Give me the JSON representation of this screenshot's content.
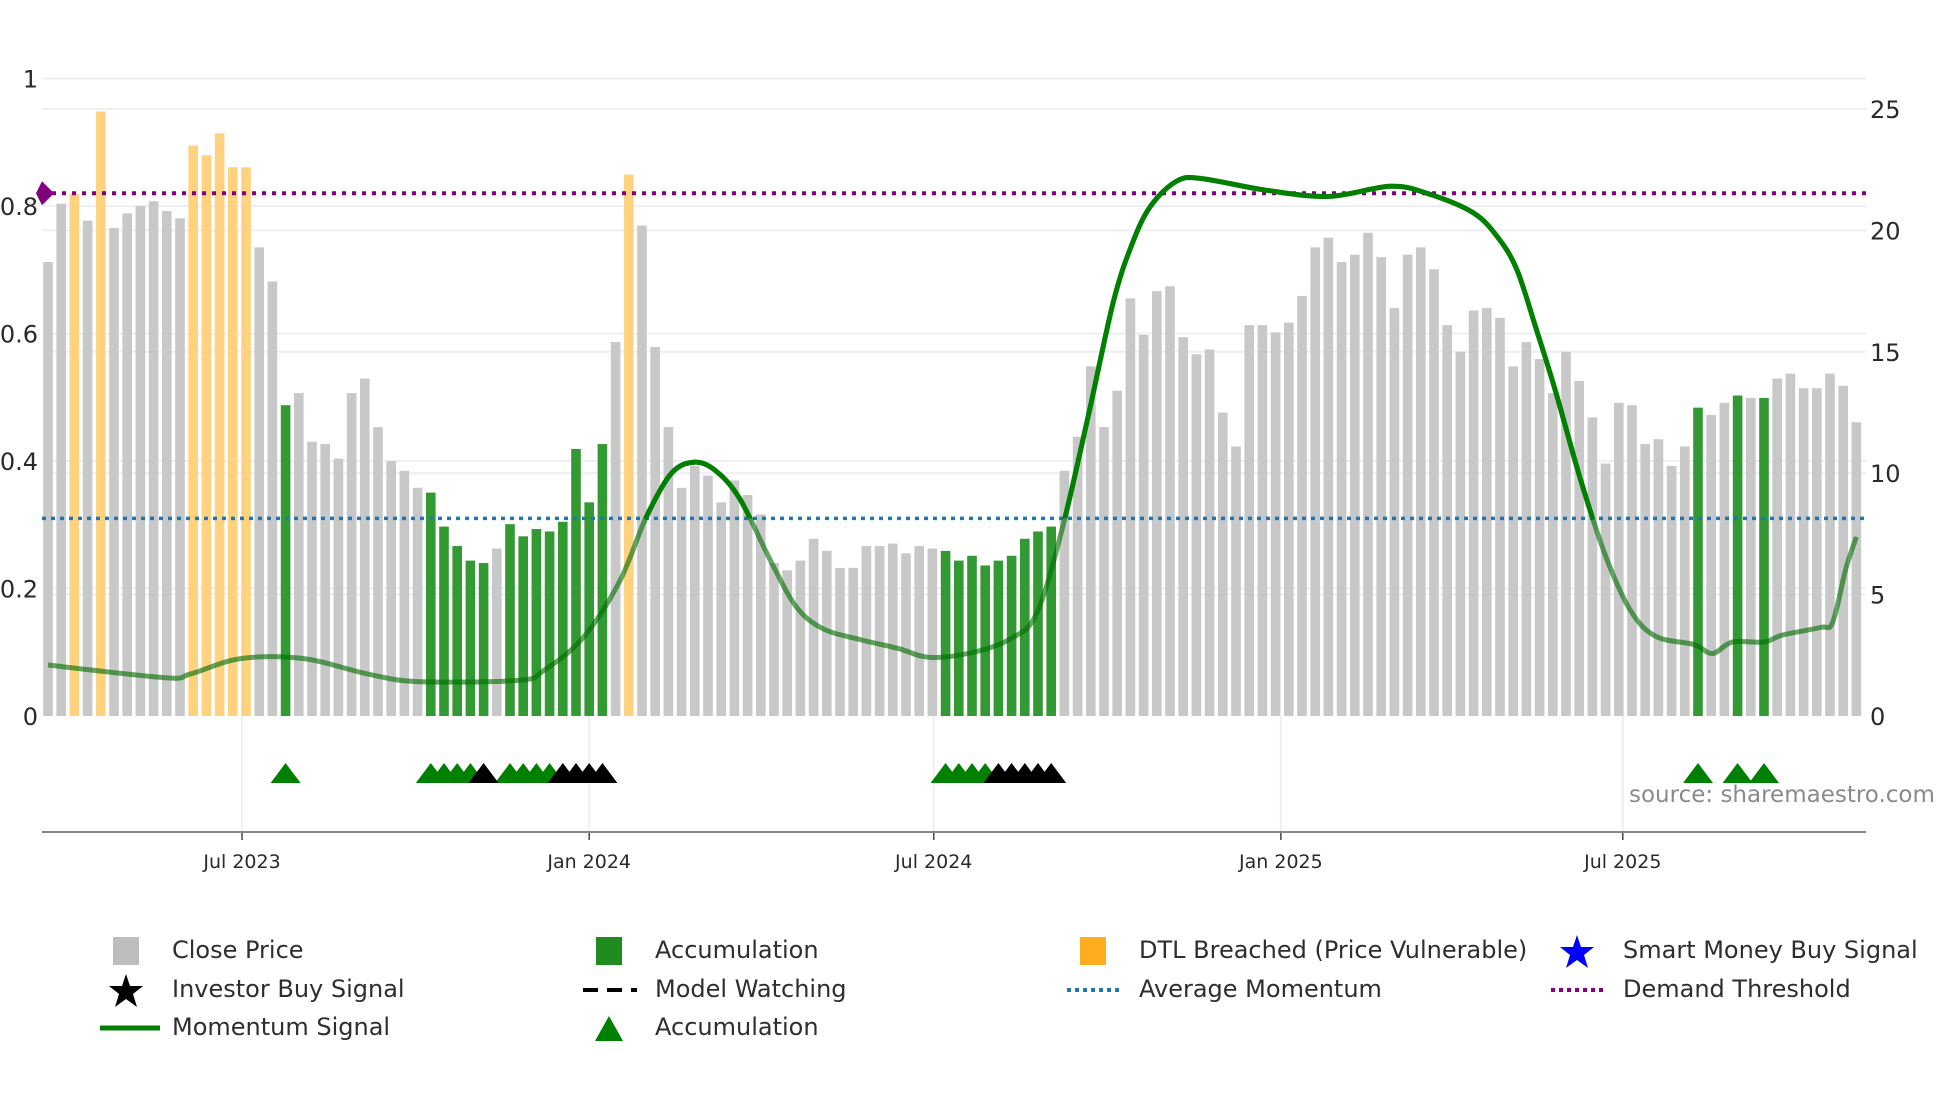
{
  "chart_data": {
    "type": "bar",
    "xunit": "week index (weekly bars)",
    "left_axis": {
      "range": [
        0,
        1
      ],
      "ticks": [
        0,
        0.2,
        0.4,
        0.6,
        0.8,
        1
      ],
      "tick_labels": [
        "0",
        "0.2",
        "0.4",
        "0.6",
        "0.8",
        "1"
      ]
    },
    "right_axis": {
      "range": [
        0,
        25
      ],
      "ticks": [
        0,
        5,
        10,
        15,
        20,
        25
      ],
      "tick_labels": [
        "0",
        "5",
        "10",
        "15",
        "20",
        "25"
      ]
    },
    "x_ticks": [
      {
        "label": "Jul 2023",
        "at": 15.7
      },
      {
        "label": "Jan 2024",
        "at": 42.0
      },
      {
        "label": "Jul 2024",
        "at": 68.1
      },
      {
        "label": "Jan 2025",
        "at": 94.4
      },
      {
        "label": "Jul 2025",
        "at": 120.3
      }
    ],
    "close_price": [
      18.7,
      21.1,
      21.5,
      20.4,
      24.9,
      20.1,
      20.7,
      21.0,
      21.2,
      20.8,
      20.5,
      23.5,
      23.1,
      24.0,
      22.6,
      22.6,
      19.3,
      17.9,
      12.8,
      13.3,
      11.3,
      11.2,
      10.6,
      13.3,
      13.9,
      11.9,
      10.5,
      10.1,
      9.4,
      9.2,
      7.8,
      7.0,
      6.4,
      6.3,
      6.9,
      7.9,
      7.4,
      7.7,
      7.6,
      8.0,
      11.0,
      8.8,
      11.2,
      15.4,
      22.3,
      20.2,
      15.2,
      11.9,
      9.4,
      10.3,
      9.9,
      8.8,
      9.7,
      9.1,
      8.3,
      6.3,
      6.0,
      6.4,
      7.3,
      6.8,
      6.1,
      6.1,
      7.0,
      7.0,
      7.1,
      6.7,
      7.0,
      6.9,
      6.8,
      6.4,
      6.6,
      6.2,
      6.4,
      6.6,
      7.3,
      7.6,
      7.8,
      10.1,
      11.5,
      14.4,
      11.9,
      13.4,
      17.2,
      15.7,
      17.5,
      17.7,
      15.6,
      14.9,
      15.1,
      12.5,
      11.1,
      16.1,
      16.1,
      15.8,
      16.2,
      17.3,
      19.3,
      19.7,
      18.7,
      19.0,
      19.9,
      18.9,
      16.8,
      19.0,
      19.3,
      18.4,
      16.1,
      15.0,
      16.7,
      16.8,
      16.4,
      14.4,
      15.4,
      14.7,
      13.3,
      15.0,
      13.8,
      12.3,
      10.4,
      12.9,
      12.8,
      11.2,
      11.4,
      10.3,
      11.1,
      12.7,
      12.4,
      12.9,
      13.2,
      13.1,
      13.1,
      13.9,
      14.1,
      13.5,
      13.5,
      14.1,
      13.6,
      12.1
    ],
    "dtl_breached_weeks": [
      3,
      5,
      12,
      13,
      14,
      15,
      16,
      45
    ],
    "accumulation_weeks": [
      19,
      30,
      31,
      32,
      33,
      34,
      36,
      37,
      38,
      39,
      40,
      41,
      42,
      43,
      69,
      70,
      71,
      72,
      73,
      74,
      75,
      76,
      77,
      126,
      129,
      131
    ],
    "accumulation_marker_weeks": [
      19,
      30,
      31,
      32,
      33,
      36,
      37,
      38,
      39,
      69,
      70,
      71,
      72,
      126,
      129,
      131
    ],
    "model_watching_marker_weeks": [
      34,
      40,
      41,
      42,
      43,
      73,
      74,
      75,
      76,
      77
    ],
    "momentum_signal": [
      [
        1,
        0.08
      ],
      [
        9.9,
        0.06
      ],
      [
        11.8,
        0.066
      ],
      [
        15.6,
        0.09
      ],
      [
        20.4,
        0.09
      ],
      [
        25.2,
        0.066
      ],
      [
        29,
        0.054
      ],
      [
        36.7,
        0.056
      ],
      [
        38.6,
        0.072
      ],
      [
        41.5,
        0.122
      ],
      [
        44.3,
        0.211
      ],
      [
        46.3,
        0.311
      ],
      [
        48.2,
        0.38
      ],
      [
        49.9,
        0.398
      ],
      [
        51.5,
        0.386
      ],
      [
        53.4,
        0.341
      ],
      [
        55.8,
        0.241
      ],
      [
        57.7,
        0.171
      ],
      [
        59.7,
        0.137
      ],
      [
        62.5,
        0.12
      ],
      [
        65.4,
        0.106
      ],
      [
        67.8,
        0.092
      ],
      [
        71.1,
        0.1
      ],
      [
        74,
        0.122
      ],
      [
        75.9,
        0.161
      ],
      [
        77.8,
        0.291
      ],
      [
        79.8,
        0.47
      ],
      [
        81.7,
        0.649
      ],
      [
        83.1,
        0.739
      ],
      [
        84.5,
        0.799
      ],
      [
        86.5,
        0.839
      ],
      [
        88.4,
        0.843
      ],
      [
        93.2,
        0.825
      ],
      [
        98,
        0.815
      ],
      [
        102.7,
        0.831
      ],
      [
        105.6,
        0.819
      ],
      [
        109,
        0.789
      ],
      [
        110.9,
        0.749
      ],
      [
        112.3,
        0.699
      ],
      [
        113.7,
        0.61
      ],
      [
        115.2,
        0.51
      ],
      [
        117.1,
        0.371
      ],
      [
        119,
        0.251
      ],
      [
        120.9,
        0.165
      ],
      [
        122.8,
        0.125
      ],
      [
        125.7,
        0.112
      ],
      [
        127.1,
        0.098
      ],
      [
        128.6,
        0.116
      ],
      [
        131,
        0.116
      ],
      [
        132.4,
        0.127
      ],
      [
        135.3,
        0.139
      ],
      [
        136.2,
        0.147
      ],
      [
        137.2,
        0.231
      ],
      [
        138,
        0.281
      ]
    ],
    "average_momentum": 0.31,
    "demand_threshold": 0.82,
    "source": "source: sharemaestro.com",
    "colors": {
      "close_price": "#c8c8c8",
      "accumulation": "#339933",
      "dtl_breached": "#ffd27f",
      "momentum": "#008000",
      "average_momentum": "#1f77b4",
      "demand_threshold": "#800080",
      "marker_accumulation": "#008000",
      "marker_model_watching": "#000000"
    },
    "legend": [
      {
        "label": "Close Price",
        "icon": "gray-square"
      },
      {
        "label": "Accumulation",
        "icon": "green-square"
      },
      {
        "label": "DTL Breached (Price Vulnerable)",
        "icon": "orange-square"
      },
      {
        "label": "Smart Money Buy Signal",
        "icon": "blue-star"
      },
      {
        "label": "Investor Buy Signal",
        "icon": "black-star"
      },
      {
        "label": "Model Watching",
        "icon": "black-dashed-line"
      },
      {
        "label": "Average Momentum",
        "icon": "blue-dotted-line"
      },
      {
        "label": "Demand Threshold",
        "icon": "purple-dotted-line"
      },
      {
        "label": "Momentum Signal",
        "icon": "green-line"
      },
      {
        "label": "Accumulation",
        "icon": "green-triangle"
      }
    ]
  }
}
